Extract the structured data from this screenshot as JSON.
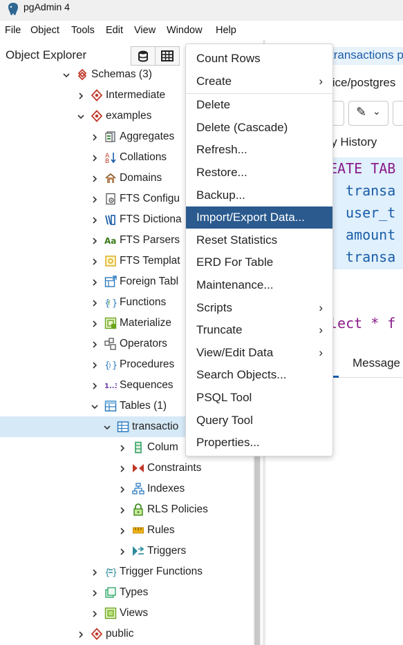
{
  "window": {
    "title": "pgAdmin 4"
  },
  "menubar": [
    "File",
    "Object",
    "Tools",
    "Edit",
    "View",
    "Window",
    "Help"
  ],
  "object_explorer": {
    "title": "Object Explorer",
    "tree": [
      {
        "label": "Schemas (3)",
        "icon": "schemas-icon",
        "level": 3,
        "state": "expanded"
      },
      {
        "label": "Intermediate",
        "icon": "schema-icon",
        "level": 4,
        "state": "collapsed"
      },
      {
        "label": "examples",
        "icon": "schema-icon",
        "level": 4,
        "state": "expanded"
      },
      {
        "label": "Aggregates",
        "icon": "aggregates-icon",
        "level": 5,
        "state": "collapsed"
      },
      {
        "label": "Collations",
        "icon": "collations-icon",
        "level": 5,
        "state": "collapsed"
      },
      {
        "label": "Domains",
        "icon": "domains-icon",
        "level": 5,
        "state": "collapsed"
      },
      {
        "label": "FTS Configu",
        "icon": "fts-config-icon",
        "level": 5,
        "state": "collapsed"
      },
      {
        "label": "FTS Dictiona",
        "icon": "fts-dictionary-icon",
        "level": 5,
        "state": "collapsed"
      },
      {
        "label": "FTS Parsers",
        "icon": "fts-parser-icon",
        "level": 5,
        "state": "collapsed"
      },
      {
        "label": "FTS Templat",
        "icon": "fts-template-icon",
        "level": 5,
        "state": "collapsed"
      },
      {
        "label": "Foreign Tabl",
        "icon": "foreign-table-icon",
        "level": 5,
        "state": "collapsed"
      },
      {
        "label": "Functions",
        "icon": "functions-icon",
        "level": 5,
        "state": "collapsed"
      },
      {
        "label": "Materialize",
        "icon": "materialized-view-icon",
        "level": 5,
        "state": "collapsed"
      },
      {
        "label": "Operators",
        "icon": "operators-icon",
        "level": 5,
        "state": "collapsed"
      },
      {
        "label": "Procedures",
        "icon": "procedures-icon",
        "level": 5,
        "state": "collapsed"
      },
      {
        "label": "Sequences",
        "icon": "sequences-icon",
        "level": 5,
        "state": "collapsed"
      },
      {
        "label": "Tables (1)",
        "icon": "tables-icon",
        "level": 5,
        "state": "expanded"
      },
      {
        "label": "transactio",
        "icon": "table-icon",
        "level": 6,
        "state": "expanded",
        "selected": true
      },
      {
        "label": "Colum",
        "icon": "columns-icon",
        "level": 7,
        "state": "collapsed"
      },
      {
        "label": "Constraints",
        "icon": "constraints-icon",
        "level": 7,
        "state": "collapsed"
      },
      {
        "label": "Indexes",
        "icon": "indexes-icon",
        "level": 7,
        "state": "collapsed"
      },
      {
        "label": "RLS Policies",
        "icon": "rls-policies-icon",
        "level": 7,
        "state": "collapsed"
      },
      {
        "label": "Rules",
        "icon": "rules-icon",
        "level": 7,
        "state": "collapsed"
      },
      {
        "label": "Triggers",
        "icon": "triggers-icon",
        "level": 7,
        "state": "collapsed"
      },
      {
        "label": "Trigger Functions",
        "icon": "trigger-functions-icon",
        "level": 5,
        "state": "collapsed"
      },
      {
        "label": "Types",
        "icon": "types-icon",
        "level": 5,
        "state": "collapsed"
      },
      {
        "label": "Views",
        "icon": "views-icon",
        "level": 5,
        "state": "collapsed"
      },
      {
        "label": "public",
        "icon": "schema-icon",
        "level": 4,
        "state": "collapsed"
      }
    ]
  },
  "context_menu": {
    "items": [
      {
        "label": "Count Rows"
      },
      {
        "label": "Create",
        "submenu": true
      },
      {
        "separator": true
      },
      {
        "label": "Delete"
      },
      {
        "label": "Delete (Cascade)"
      },
      {
        "label": "Refresh..."
      },
      {
        "label": "Restore..."
      },
      {
        "label": "Backup..."
      },
      {
        "label": "Import/Export Data...",
        "highlighted": true
      },
      {
        "label": "Reset Statistics"
      },
      {
        "label": "ERD For Table"
      },
      {
        "label": "Maintenance..."
      },
      {
        "label": "Scripts",
        "submenu": true
      },
      {
        "label": "Truncate",
        "submenu": true
      },
      {
        "label": "View/Edit Data",
        "submenu": true
      },
      {
        "label": "Search Objects..."
      },
      {
        "label": "PSQL Tool"
      },
      {
        "label": "Query Tool"
      },
      {
        "label": "Properties..."
      }
    ]
  },
  "editor": {
    "tab_label": "transactions p",
    "connection": "tice/postgres",
    "query_history": "ery History",
    "code_lines": [
      "EATE TAB",
      "transa",
      "user_t",
      "amount",
      "transa"
    ],
    "code_line2": "lect * f",
    "bottom_tabs": [
      "ut",
      "Message"
    ]
  },
  "colors": {
    "highlight": "#2a5a8e",
    "selection": "#d6e9f7",
    "accent": "#1a5da8",
    "schema_red": "#c0392b"
  }
}
